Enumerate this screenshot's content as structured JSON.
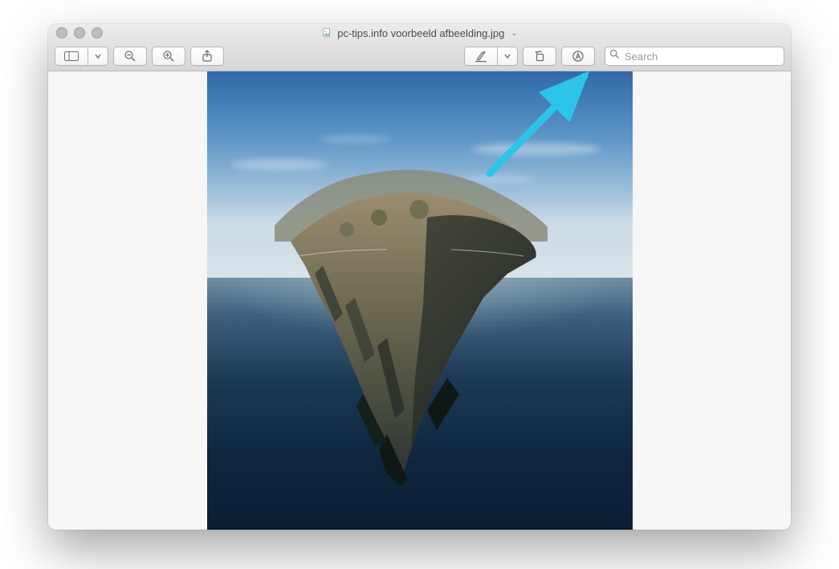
{
  "window": {
    "title": "pc-tips.info voorbeeld afbeelding.jpg",
    "dropdown_indicator": "⌄"
  },
  "toolbar": {
    "search_placeholder": "Search"
  },
  "annotation": {
    "arrow_color": "#2CC4E8"
  }
}
